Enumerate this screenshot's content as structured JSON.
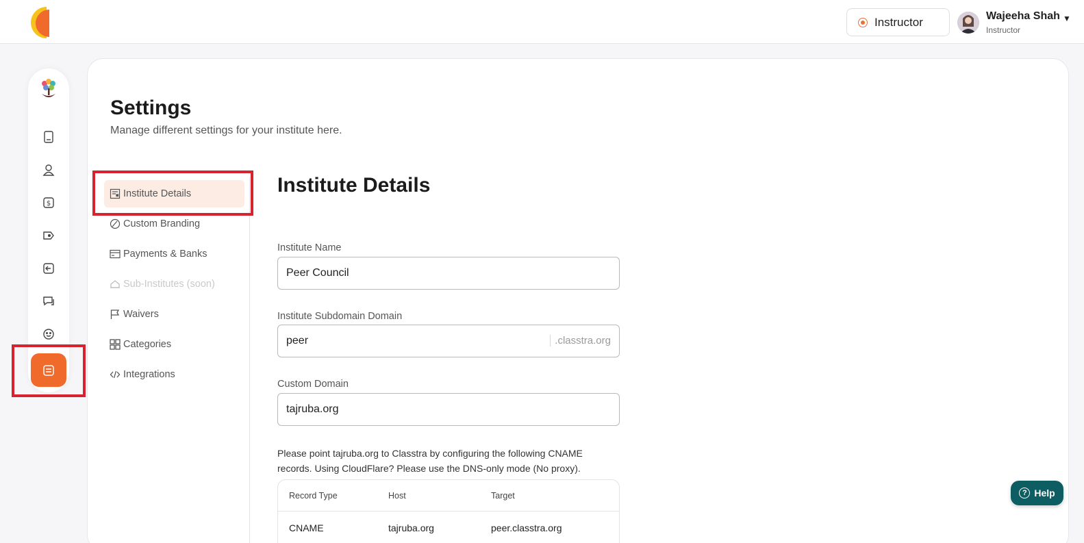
{
  "header": {
    "role_button": "Instructor",
    "user": {
      "name": "Wajeeha Shah",
      "role": "Instructor"
    }
  },
  "rail": {
    "items": [
      {
        "icon": "book-icon"
      },
      {
        "icon": "user-icon"
      },
      {
        "icon": "dollar-icon"
      },
      {
        "icon": "tag-icon"
      },
      {
        "icon": "back-arrow-icon"
      },
      {
        "icon": "chat-icon"
      },
      {
        "icon": "smile-icon"
      },
      {
        "icon": "settings-icon",
        "active": true
      }
    ]
  },
  "page": {
    "title": "Settings",
    "subtitle": "Manage different settings for your institute here."
  },
  "settings_nav": {
    "items": [
      {
        "label": "Institute Details",
        "icon": "document-icon",
        "active": true
      },
      {
        "label": "Custom Branding",
        "icon": "branding-icon"
      },
      {
        "label": "Payments & Banks",
        "icon": "card-icon"
      },
      {
        "label": "Sub-Institutes (soon)",
        "icon": "building-icon",
        "disabled": true
      },
      {
        "label": "Waivers",
        "icon": "flag-icon"
      },
      {
        "label": "Categories",
        "icon": "grid-icon"
      },
      {
        "label": "Integrations",
        "icon": "code-icon"
      }
    ]
  },
  "form": {
    "section_title": "Institute Details",
    "institute_name": {
      "label": "Institute Name",
      "value": "Peer Council"
    },
    "subdomain": {
      "label": "Institute Subdomain Domain",
      "value": "peer",
      "suffix": ".classtra.org"
    },
    "custom_domain": {
      "label": "Custom Domain",
      "value": "tajruba.org"
    },
    "info": "Please point tajruba.org to Classtra by configuring the following CNAME records. Using CloudFlare? Please use the DNS-only mode (No proxy).",
    "records": {
      "headers": [
        "Record Type",
        "Host",
        "Target"
      ],
      "rows": [
        [
          "CNAME",
          "tajruba.org",
          "peer.classtra.org"
        ]
      ]
    }
  },
  "help": {
    "label": "Help"
  },
  "colors": {
    "accent": "#f06a2c",
    "highlight": "#d6232e",
    "help_bg": "#0d5d62"
  }
}
